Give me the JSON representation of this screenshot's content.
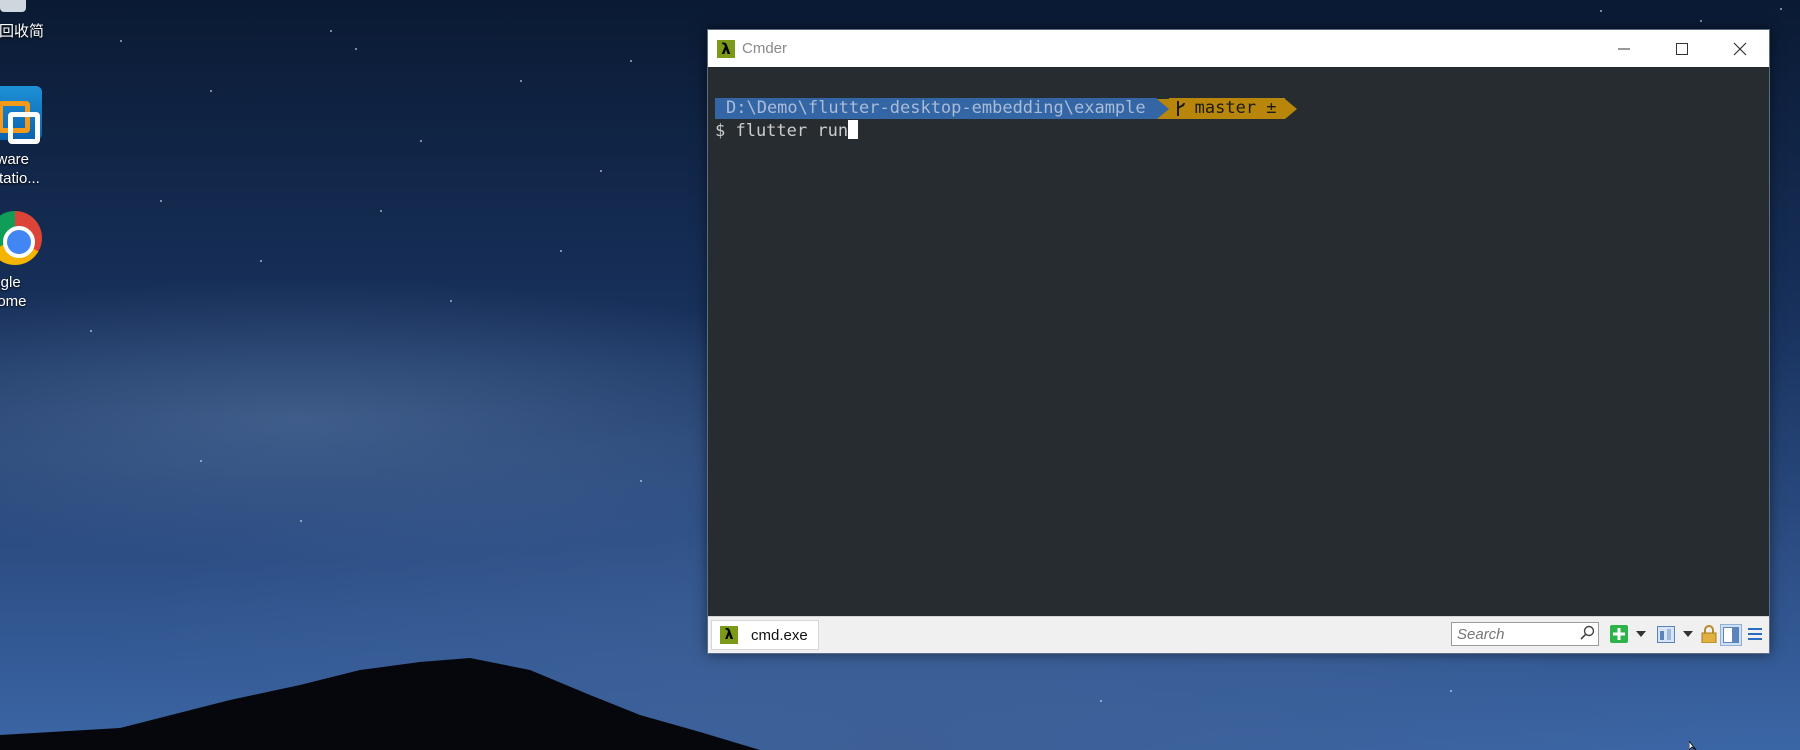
{
  "desktop": {
    "icons": [
      {
        "label": "家回收简",
        "icon": "recycle-bin-icon"
      },
      {
        "label": "Mware\nkstatio...",
        "icon": "vmware-icon"
      },
      {
        "label": "oogle\nhrome",
        "icon": "chrome-icon"
      }
    ]
  },
  "window": {
    "title": "Cmder",
    "app_icon": "λ",
    "controls": {
      "minimize": "minimize-icon",
      "maximize": "maximize-icon",
      "close": "close-icon"
    }
  },
  "console": {
    "path": "D:\\Demo\\flutter-desktop-embedding\\example",
    "git_branch_icon": "git-branch-icon",
    "git_branch": "master ±",
    "command": "$ flutter run"
  },
  "statusbar": {
    "tab_icon": "λ",
    "tab_label": "cmd.exe",
    "search_placeholder": "Search",
    "tools": [
      "new-console-icon",
      "dropdown-icon",
      "switch-console-icon",
      "dropdown-icon",
      "lock-icon",
      "split-view-icon",
      "menu-icon"
    ]
  },
  "colors": {
    "path_segment": "#3465a4",
    "git_segment": "#b8860b",
    "console_background": "#272c31",
    "app_icon": "#7b9a1a"
  }
}
